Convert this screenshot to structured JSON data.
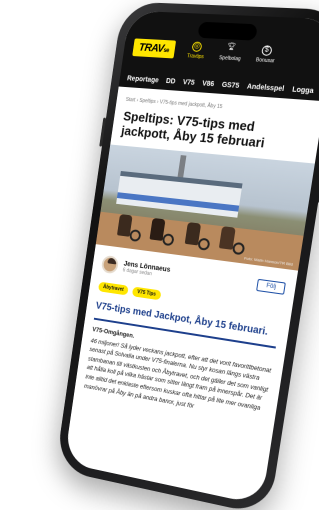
{
  "app": {
    "logo": "TRAV",
    "logo_suffix": "se",
    "tabs": [
      {
        "label": "Travtips",
        "icon": "target-icon",
        "active": true
      },
      {
        "label": "Spelbolag",
        "icon": "trophy-icon",
        "active": false
      },
      {
        "label": "Bonusar",
        "icon": "dollar-icon",
        "active": false
      }
    ]
  },
  "subnav": {
    "items": [
      "Reportage",
      "DD",
      "V75",
      "V86",
      "GS75",
      "Andelsspel",
      "Logga"
    ],
    "search_icon": "search-icon"
  },
  "article": {
    "breadcrumb": "Start › Speltips › V75-tips med jackpott, Åby 15",
    "title": "Speltips: V75-tips med jackpott, Åby 15 februari",
    "photo_credit": "Foto: Malin Hanson/TR Bild",
    "author": {
      "name": "Jens Lönnaeus",
      "date": "6 dagar sedan"
    },
    "follow_label": "Följ",
    "tags": [
      "Åbytravet",
      "V75 Tips"
    ],
    "heading": "V75-tips med Jackpot, Åby 15 februari.",
    "body_lead": "V75-Omgången.",
    "body": "46 miljoner! Så lyder veckans jackpott, efter att det vorit favorittbetonat senast på Solvalla under V75-finalerna. Nu styr kosan längs västra stambanan till västkusten och Åbytravet, och det gäller det som vanligt att hålla koll på vilka hästar som sitter längt fram på innerspår. Det är inte alltid det enklaste eftersom kuskar ofta hittar på lite mer ovanliga manövrar på Åby än på andra banor, just för"
  },
  "colors": {
    "brand_yellow": "#ffe600",
    "nav_dark": "#111111",
    "heading_blue": "#1d3f8c"
  }
}
